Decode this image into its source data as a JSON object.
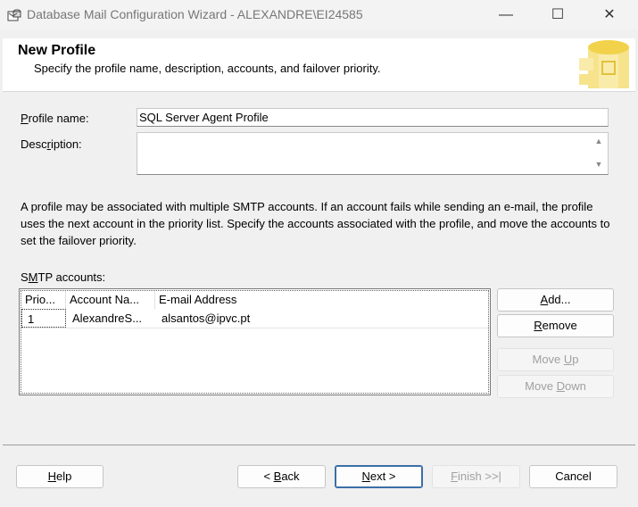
{
  "window": {
    "title": "Database Mail Configuration Wizard - ALEXANDRE\\EI24585",
    "icon": "database-mail-icon",
    "minimize_glyph": "—",
    "maximize_glyph": "☐",
    "close_glyph": "✕"
  },
  "header": {
    "title": "New Profile",
    "subtitle": "Specify the profile name, description, accounts, and failover priority."
  },
  "form": {
    "profile_name_label": {
      "pre": "",
      "key": "P",
      "post": "rofile name:"
    },
    "profile_name_value": "SQL Server Agent Profile",
    "description_label": {
      "pre": "Desc",
      "key": "r",
      "post": "iption:"
    },
    "description_value": ""
  },
  "info_text": "A profile may be associated with multiple SMTP accounts. If an account fails while sending an e-mail, the profile uses the next account in the priority list. Specify the accounts associated with the profile, and move the accounts to set the failover priority.",
  "smtp": {
    "label": {
      "pre": "S",
      "key": "M",
      "post": "TP accounts:"
    },
    "columns": [
      "Prio...",
      "Account Na...",
      "E-mail Address"
    ],
    "rows": [
      {
        "priority": "1",
        "account": "AlexandreS...",
        "email": "alsantos@ipvc.pt"
      }
    ]
  },
  "side_buttons": {
    "add": {
      "pre": "",
      "key": "A",
      "post": "dd..."
    },
    "remove": {
      "pre": "",
      "key": "R",
      "post": "emove"
    },
    "move_up": {
      "pre": "Move ",
      "key": "U",
      "post": "p"
    },
    "move_down": {
      "pre": "Move ",
      "key": "D",
      "post": "own"
    }
  },
  "footer": {
    "help": {
      "pre": "",
      "key": "H",
      "post": "elp"
    },
    "back": {
      "pre": "< ",
      "key": "B",
      "post": "ack"
    },
    "next": {
      "pre": "",
      "key": "N",
      "post": "ext >"
    },
    "finish": {
      "pre": "",
      "key": "F",
      "post": "inish >>|"
    },
    "cancel": "Cancel"
  },
  "colors": {
    "banner_art": "#f2d24a",
    "default_button_border": "#3b6fa6",
    "disabled_text": "#a0a0a0"
  }
}
